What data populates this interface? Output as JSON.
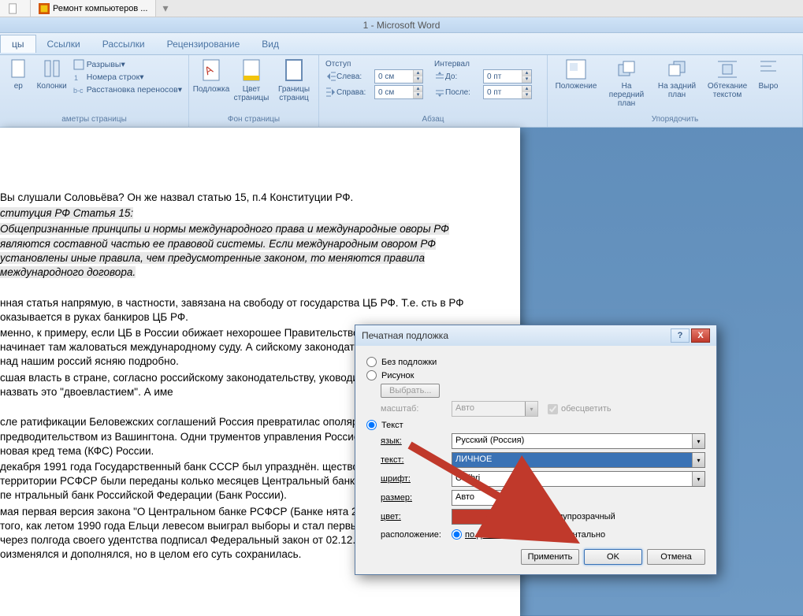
{
  "browser": {
    "tab1": "",
    "tab2": "Ремонт компьютеров ..."
  },
  "title": "1 - Microsoft Word",
  "ribbon_tabs": {
    "t1": "цы",
    "t2": "Ссылки",
    "t3": "Рассылки",
    "t4": "Рецензирование",
    "t5": "Вид"
  },
  "ribbon": {
    "g1": {
      "item1": "ер",
      "item2": "Колонки",
      "label": "аметры страницы",
      "small1": "Разрывы",
      "small2": "Номера строк",
      "small3": "Расстановка переносов"
    },
    "g2": {
      "btn1": "Подложка",
      "btn2": "Цвет страницы",
      "btn3": "Границы страниц",
      "label": "Фон страницы"
    },
    "g3": {
      "h1": "Отступ",
      "h2": "Интервал",
      "left": "Слева:",
      "right": "Справа:",
      "before": "До:",
      "after": "После:",
      "v_left": "0 см",
      "v_right": "0 см",
      "v_before": "0 пт",
      "v_after": "0 пт",
      "label": "Абзац"
    },
    "g4": {
      "b1": "Положение",
      "b2": "На передний план",
      "b3": "На задний план",
      "b4": "Обтекание текстом",
      "b5": "Выро",
      "label": "Упорядочить"
    }
  },
  "doc": {
    "p1": "Вы слушали Соловьёва? Он же назвал статью 15, п.4 Конституции РФ.",
    "p2": "ституция РФ Статья 15:",
    "p3": "Общепризнанные принципы и нормы международного права и международные оворы РФ являются составной частью ее правовой системы. Если международным овором РФ установлены иные правила, чем предусмотренные законом, то меняются правила международного договора.",
    "p4": "нная статья напрямую, в частности, завязана на свободу от государства ЦБ РФ. Т.е. сть в РФ оказывается в руках банкиров ЦБ РФ.",
    "p5": "менно, к примеру, если ЦБ в России обижает нехорошее Правительство, он идёт куда-за бугор» и начинает там жаловаться международному суду. А сийскому законодательству имеет приоритет над нашим россий ясняю подробно.",
    "p6": "сшая власть в стране, согласно российскому законодательству, уководителей ЦБ РФ. Можете назвать это \"двоевластием\". А име",
    "p7": "сле ратификации Беловежских соглашений Россия превратилас ополярного мира под предводительством из Вашингтона. Одни трументов управления Россией, как колонией, стала новая кред тема (КФС) России.",
    "p8": "декабря 1991 года Государственный банк СССР был упразднён. щество Госбанка СССР на территории РСФСР были переданы колько месяцев Центральный банк РСФСР (Банк России) был пе нтральный банк Российской Федерации (Банк России).",
    "p9": "мая первая версия закона \"О Центральном банке РСФСР (Банке нята 2 декабря 1990 года, после того, как летом 1990 года Ельци левесом выиграл выборы и стал первым президентом России, и через полгода своего удентства подписал Федеральный закон от 02.12.1990 № 394-1. Закон оизменялся и дополнялся, но в целом его суть сохранилась."
  },
  "dialog": {
    "title": "Печатная подложка",
    "opt1": "Без подложки",
    "opt2": "Рисунок",
    "opt3": "Текст",
    "choose": "Выбрать...",
    "scale_l": "масштаб:",
    "scale_v": "Авто",
    "washout": "обесцветить",
    "lang_l": "язык:",
    "lang_v": "Русский (Россия)",
    "text_l": "текст:",
    "text_v": "ЛИЧНОЕ",
    "font_l": "шрифт:",
    "font_v": "Calibri",
    "size_l": "размер:",
    "size_v": "Авто",
    "color_l": "цвет:",
    "semi": "полупрозрачный",
    "layout_l": "расположение:",
    "diag": "по диагонали",
    "horiz": "горизонтально",
    "apply": "Применить",
    "ok": "OK",
    "cancel": "Отмена"
  }
}
